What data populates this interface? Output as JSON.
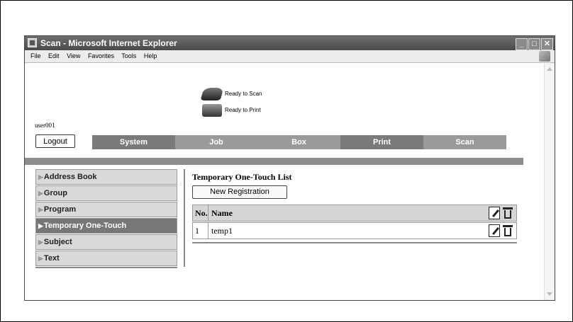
{
  "window": {
    "title": "Scan - Microsoft Internet Explorer"
  },
  "menu": [
    "File",
    "Edit",
    "View",
    "Favorites",
    "Tools",
    "Help"
  ],
  "status": {
    "scan": "Ready to Scan",
    "print": "Ready to Print"
  },
  "user": "user001",
  "logout_label": "Logout",
  "tabs": [
    {
      "label": "System",
      "color": "#7a7a7a"
    },
    {
      "label": "Job",
      "color": "#9a9a9a"
    },
    {
      "label": "Box",
      "color": "#9a9a9a"
    },
    {
      "label": "Print",
      "color": "#7a7a7a"
    },
    {
      "label": "Scan",
      "color": "#9a9a9a"
    }
  ],
  "sidebar": {
    "items": [
      {
        "label": "Address Book",
        "active": false
      },
      {
        "label": "Group",
        "active": false
      },
      {
        "label": "Program",
        "active": false
      },
      {
        "label": "Temporary One-Touch",
        "active": true
      },
      {
        "label": "Subject",
        "active": false
      },
      {
        "label": "Text",
        "active": false
      }
    ]
  },
  "main": {
    "title": "Temporary One-Touch List",
    "new_button": "New Registration",
    "columns": {
      "no": "No.",
      "name": "Name"
    },
    "rows": [
      {
        "no": "1",
        "name": "temp1"
      }
    ]
  }
}
